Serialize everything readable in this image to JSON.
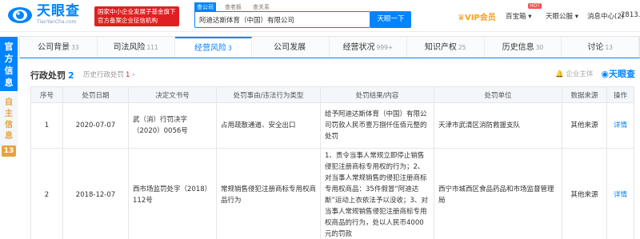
{
  "header": {
    "logo_cn": "天眼查",
    "logo_en": "TianYanCha.com",
    "slogan_line1": "国家中小企业发展子基金旗下",
    "slogan_line2": "官方备案企业征信机构",
    "search_tabs": [
      "查公司",
      "查老板",
      "查关系"
    ],
    "search_value": "阿迪达斯体育（中国）有限公司",
    "search_button": "天眼一下",
    "vip": "VIP会员",
    "hot": "HOT",
    "nav_items": [
      "百宝箱",
      "天眼公服",
      "消息中心",
      "2",
      "2813..."
    ]
  },
  "side": {
    "official": [
      "官",
      "方",
      "信",
      "息"
    ],
    "self": [
      "自",
      "主",
      "信",
      "息"
    ],
    "self_count": "13"
  },
  "tabs": [
    {
      "label": "公司背景",
      "count": "33"
    },
    {
      "label": "司法风险",
      "count": "111"
    },
    {
      "label": "经营风险",
      "count": "3"
    },
    {
      "label": "公司发展",
      "count": ""
    },
    {
      "label": "经营状况",
      "count": "999+"
    },
    {
      "label": "知识产权",
      "count": "25"
    },
    {
      "label": "历史信息",
      "count": "30"
    },
    {
      "label": "讨论",
      "count": "13"
    }
  ],
  "section": {
    "title": "行政处罚",
    "count": "2",
    "history_label": "历史行政处罚",
    "history_count": "1",
    "enterprise_label": "企业主体",
    "brand": "天眼查"
  },
  "table": {
    "headers": [
      "序号",
      "处罚日期",
      "决定文书号",
      "处罚事由/违法行为类型",
      "处罚结果/内容",
      "处罚单位",
      "数据来源",
      "操作"
    ],
    "rows": [
      [
        "1",
        "2020-07-07",
        "武（消）行罚决字（2020）0056号",
        "占用疏散通道、安全出口",
        "给予阿迪达斯体育（中国）有限公司罚款人民币壹万捌仟伍佰元整的处罚",
        "天津市武清区消防救援支队",
        "其他来源",
        "详情"
      ],
      [
        "2",
        "2018-12-07",
        "西市场监罚处字（2018）112号",
        "常规销售侵犯注册商标专用权商品行为",
        "1、责令当事人常规立即停止销售侵犯注册商标专用权的行为；2、对当事人常规销售的侵犯注册商标专用权商品：35件假冒“阿迪达斯”运动上衣依法予以没收；3、对当事人常规销售侵犯注册商标专用权商品的行为，处以人民币4000元的罚款",
        "西宁市城西区食品药品和市场监督管理局",
        "其他来源",
        "详情"
      ]
    ]
  }
}
